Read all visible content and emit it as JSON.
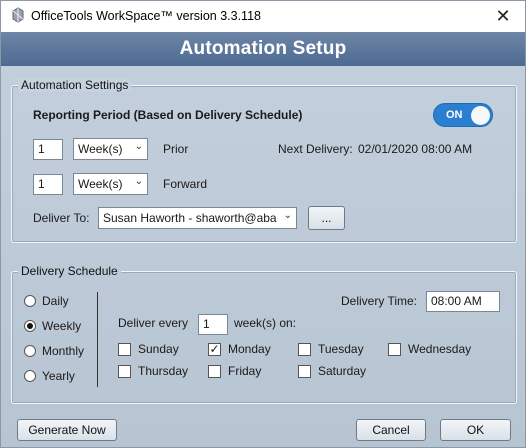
{
  "window": {
    "title": "OfficeTools WorkSpace™ version 3.3.118",
    "close_glyph": "✕"
  },
  "header": {
    "title": "Automation Setup"
  },
  "automation_settings": {
    "legend": "Automation Settings",
    "reporting_period_label": "Reporting Period (Based on Delivery Schedule)",
    "toggle_label": "ON",
    "toggle_on": true,
    "prior": {
      "value": "1",
      "unit": "Week(s)",
      "label": "Prior"
    },
    "forward": {
      "value": "1",
      "unit": "Week(s)",
      "label": "Forward"
    },
    "next_delivery_label": "Next Delivery:",
    "next_delivery_value": "02/01/2020 08:00 AM",
    "deliver_to_label": "Deliver To:",
    "deliver_to_value": "Susan  Haworth - shaworth@aba",
    "browse_label": "..."
  },
  "delivery_schedule": {
    "legend": "Delivery Schedule",
    "frequencies": [
      {
        "label": "Daily",
        "selected": false
      },
      {
        "label": "Weekly",
        "selected": true
      },
      {
        "label": "Monthly",
        "selected": false
      },
      {
        "label": "Yearly",
        "selected": false
      }
    ],
    "delivery_time_label": "Delivery Time:",
    "delivery_time_value": "08:00 AM",
    "deliver_every_label": "Deliver every",
    "deliver_every_value": "1",
    "weeks_on_label": "week(s) on:",
    "days": [
      {
        "label": "Sunday",
        "checked": false
      },
      {
        "label": "Monday",
        "checked": true
      },
      {
        "label": "Tuesday",
        "checked": false
      },
      {
        "label": "Wednesday",
        "checked": false
      },
      {
        "label": "Thursday",
        "checked": false
      },
      {
        "label": "Friday",
        "checked": false
      },
      {
        "label": "Saturday",
        "checked": false
      }
    ]
  },
  "footer": {
    "generate_label": "Generate Now",
    "cancel_label": "Cancel",
    "ok_label": "OK"
  },
  "colors": {
    "banner": "#5a769c",
    "toggle": "#2a7fd0"
  }
}
